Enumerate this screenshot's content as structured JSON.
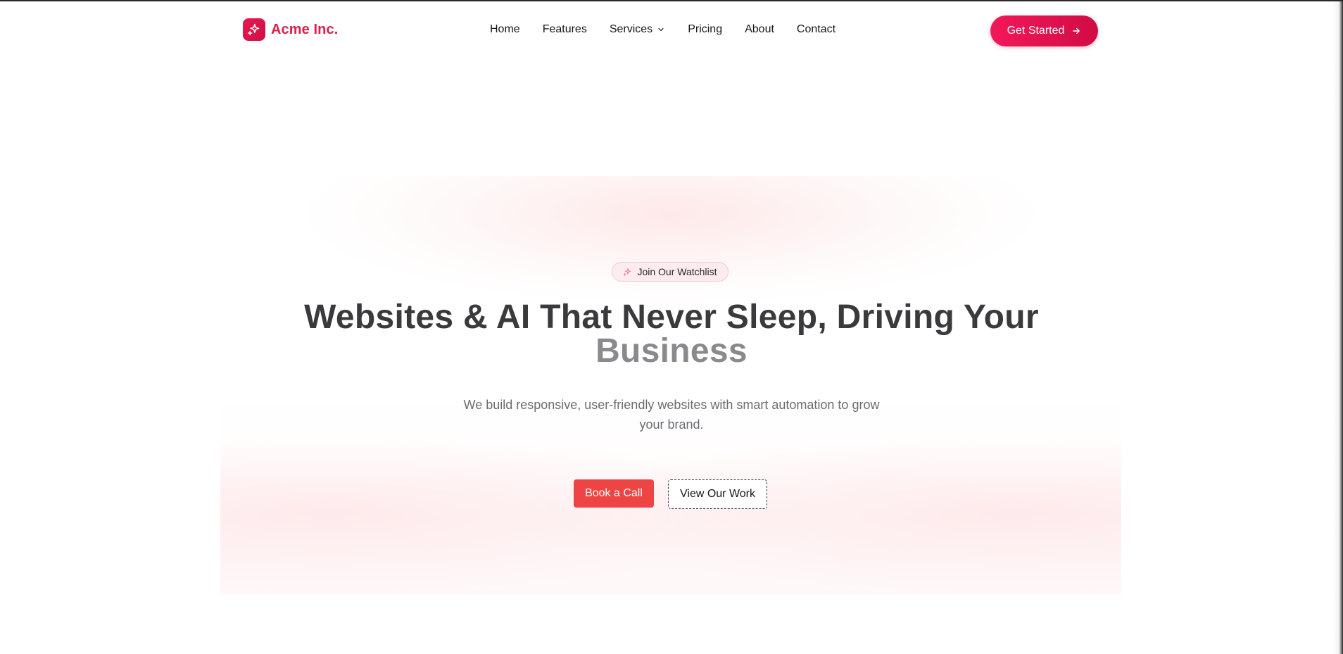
{
  "nav": {
    "brand_name": "Acme Inc.",
    "brand_icon": "sparkles-icon",
    "links": [
      {
        "label": "Home"
      },
      {
        "label": "Features"
      },
      {
        "label": "Services",
        "has_dropdown": true
      },
      {
        "label": "Pricing"
      },
      {
        "label": "About"
      },
      {
        "label": "Contact"
      }
    ],
    "cta_label": "Get Started",
    "cta_icon": "arrow-right-icon"
  },
  "hero": {
    "badge_label": "Join Our Watchlist",
    "badge_icon": "sparkles-icon",
    "headline_line1": "Websites & AI That Never Sleep, Driving Your",
    "headline_line2": "Business",
    "subtext": "We build responsive, user-friendly websites with smart automation to grow your brand.",
    "primary_button": "Book a Call",
    "secondary_button": "View Our Work"
  },
  "colors": {
    "brand": "#e11d48",
    "primary_button": "#ef4444",
    "heading": "#3a3a3c",
    "heading_muted": "#8a8a8e",
    "body_text": "#6b6b72",
    "badge_bg": "#fdecef"
  }
}
